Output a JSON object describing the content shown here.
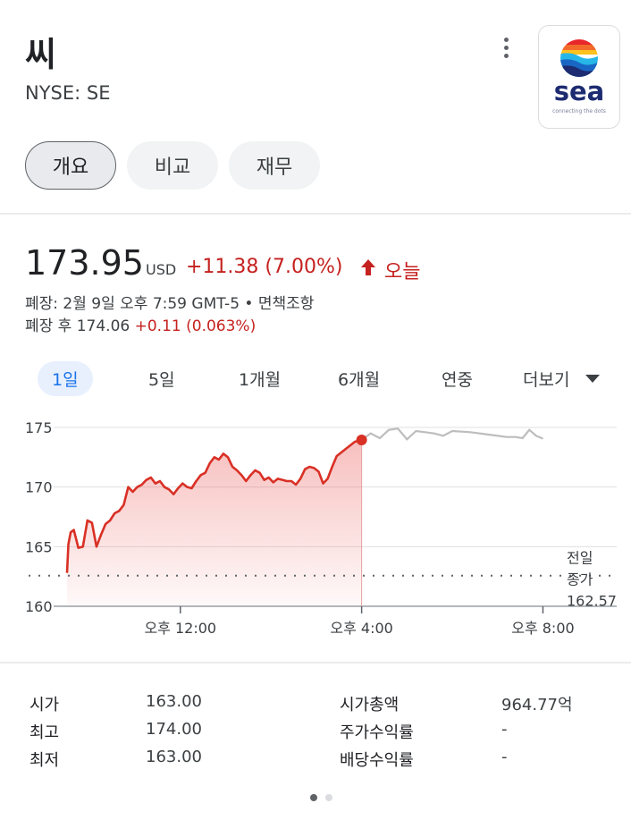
{
  "header": {
    "company_name": "씨",
    "ticker": "NYSE: SE",
    "more_icon": "more-vert-icon",
    "logo": {
      "word": "sea",
      "tagline": "connecting the dots"
    }
  },
  "tabs": [
    {
      "label": "개요",
      "active": true
    },
    {
      "label": "비교",
      "active": false
    },
    {
      "label": "재무",
      "active": false
    }
  ],
  "quote": {
    "price": "173.95",
    "currency": "USD",
    "change": "+11.38 (7.00%)",
    "direction_icon": "arrow-up-icon",
    "period": "오늘",
    "close_info": "폐장: 2월 9일 오후 7:59 GMT-5 • 면책조항",
    "after_hours_label": "폐장 후 174.06",
    "after_hours_change": "+0.11 (0.063%)"
  },
  "ranges": {
    "items": [
      "1일",
      "5일",
      "1개월",
      "6개월",
      "연중",
      "더보기"
    ],
    "selected": "1일"
  },
  "colors": {
    "up": "#c5221f",
    "accent": "#1a73e8",
    "after_hours_line": "#bdbdbd"
  },
  "chart_data": {
    "type": "line",
    "y_ticks": [
      "175",
      "170",
      "165",
      "160"
    ],
    "ylim": [
      160,
      176
    ],
    "x_ticks": [
      "오후 12:00",
      "오후 4:00",
      "오후 8:00"
    ],
    "xlim_hours": [
      9.5,
      20
    ],
    "prev_close": {
      "label_line1": "전일",
      "label_line2": "종가",
      "value": "162.57"
    },
    "session_series": {
      "x": [
        9.5,
        9.53,
        9.58,
        9.65,
        9.75,
        9.85,
        9.95,
        10.05,
        10.15,
        10.25,
        10.35,
        10.45,
        10.55,
        10.65,
        10.75,
        10.85,
        10.95,
        11.05,
        11.15,
        11.25,
        11.35,
        11.45,
        11.55,
        11.65,
        11.75,
        11.85,
        11.95,
        12.05,
        12.15,
        12.25,
        12.35,
        12.45,
        12.55,
        12.65,
        12.75,
        12.85,
        12.95,
        13.05,
        13.15,
        13.25,
        13.35,
        13.45,
        13.55,
        13.65,
        13.75,
        13.85,
        13.95,
        14.05,
        14.15,
        14.25,
        14.35,
        14.45,
        14.55,
        14.65,
        14.75,
        14.85,
        14.95,
        15.05,
        15.15,
        15.25,
        15.35,
        15.45,
        15.55,
        15.65,
        15.75,
        15.85,
        15.95,
        16.0
      ],
      "y": [
        162.8,
        165.2,
        166.2,
        166.4,
        164.9,
        165.0,
        167.2,
        167.0,
        165.0,
        166.0,
        166.9,
        167.2,
        167.8,
        168.0,
        168.5,
        170.0,
        169.6,
        170.0,
        170.2,
        170.6,
        170.8,
        170.3,
        170.5,
        170.0,
        169.8,
        169.4,
        169.9,
        170.3,
        170.0,
        169.9,
        170.5,
        171.0,
        171.2,
        172.0,
        172.5,
        172.3,
        172.8,
        172.5,
        171.7,
        171.4,
        171.0,
        170.5,
        171.0,
        171.4,
        171.2,
        170.6,
        170.8,
        170.4,
        170.7,
        170.6,
        170.5,
        170.5,
        170.2,
        170.7,
        171.5,
        171.7,
        171.6,
        171.3,
        170.3,
        170.7,
        171.7,
        172.6,
        172.9,
        173.2,
        173.5,
        173.8,
        173.9,
        173.95
      ]
    },
    "after_hours_series": {
      "x": [
        16.0,
        16.2,
        16.4,
        16.6,
        16.8,
        17.0,
        17.2,
        17.4,
        17.6,
        17.8,
        18.0,
        18.4,
        18.8,
        19.2,
        19.4,
        19.55,
        19.7,
        19.85,
        20.0
      ],
      "y": [
        173.95,
        174.5,
        174.1,
        174.8,
        174.9,
        174.0,
        174.7,
        174.6,
        174.5,
        174.3,
        174.7,
        174.6,
        174.4,
        174.2,
        174.2,
        174.1,
        174.8,
        174.3,
        174.06
      ]
    }
  },
  "stats": {
    "left": [
      {
        "label": "시가",
        "value": "163.00"
      },
      {
        "label": "최고",
        "value": "174.00"
      },
      {
        "label": "최저",
        "value": "163.00"
      }
    ],
    "right": [
      {
        "label": "시가총액",
        "value": "964.77억"
      },
      {
        "label": "주가수익률",
        "value": "-"
      },
      {
        "label": "배당수익률",
        "value": "-"
      }
    ]
  },
  "pagination": {
    "pages": 2,
    "current": 1
  }
}
